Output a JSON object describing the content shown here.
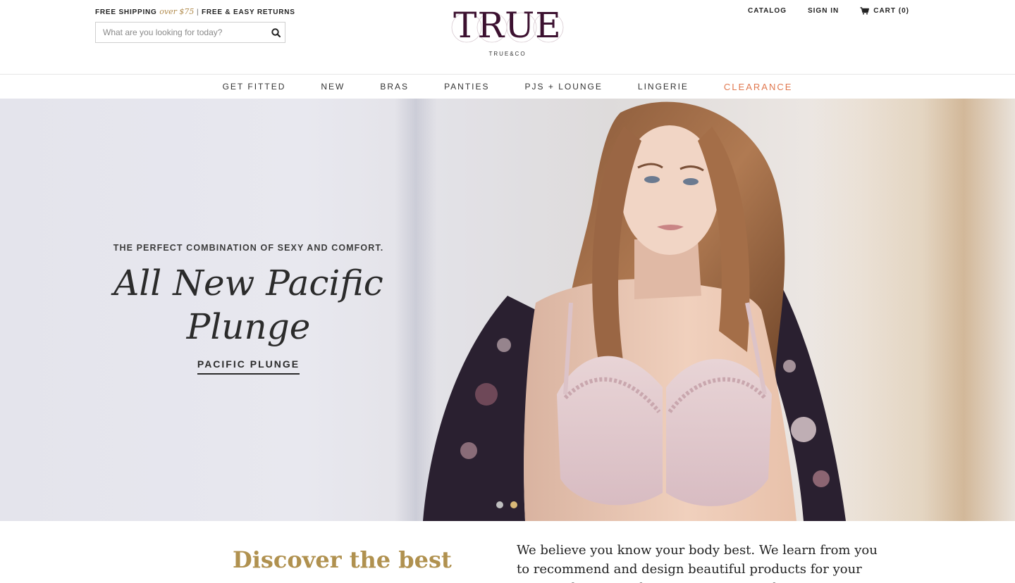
{
  "header": {
    "promo": {
      "free_shipping": "FREE SHIPPING",
      "over": "over $75",
      "separator": "|",
      "returns": "FREE & EASY RETURNS"
    },
    "search": {
      "placeholder": "What are you looking for today?",
      "icon": "search-icon"
    },
    "logo": {
      "main": "TRUE",
      "sub": "TRUE&CO"
    },
    "utility": {
      "catalog": "CATALOG",
      "sign_in": "SIGN IN",
      "cart": "CART (0)",
      "cart_icon": "cart-icon"
    }
  },
  "nav": {
    "items": [
      {
        "label": "GET FITTED"
      },
      {
        "label": "NEW"
      },
      {
        "label": "BRAS"
      },
      {
        "label": "PANTIES"
      },
      {
        "label": "PJS + LOUNGE"
      },
      {
        "label": "LINGERIE"
      },
      {
        "label": "CLEARANCE",
        "color": "#e0784f"
      }
    ]
  },
  "hero": {
    "eyebrow": "THE PERFECT COMBINATION OF SEXY AND COMFORT.",
    "title": "All New Pacific Plunge",
    "cta": "PACIFIC PLUNGE",
    "slides": 2,
    "active_slide": 2
  },
  "intro": {
    "heading": "Discover the best",
    "body": "We believe you know your body best. We learn from you to recommend and design beautiful products for your unique shape. Ready to meet your match?"
  },
  "colors": {
    "accent_gold": "#b0914f",
    "clearance": "#e0784f",
    "logo_plum": "#3c1130",
    "dot_active": "#d9b877"
  }
}
